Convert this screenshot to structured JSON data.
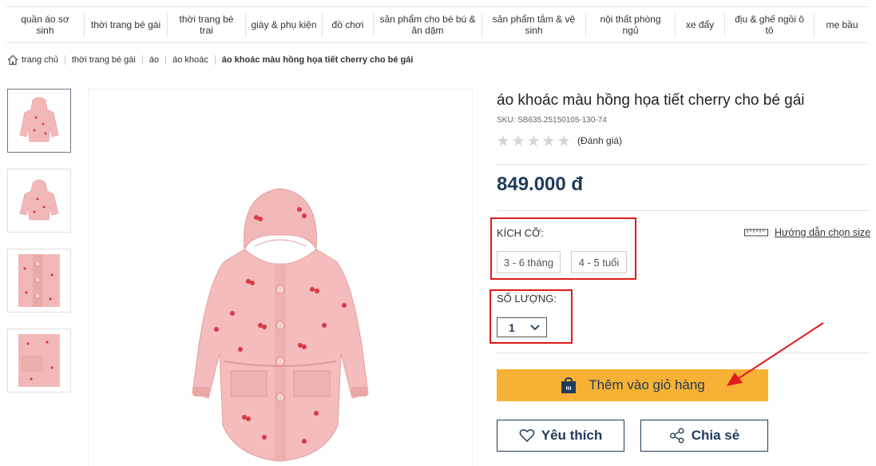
{
  "nav": {
    "items": [
      "quần áo sơ sinh",
      "thời trang bé gái",
      "thời trang bé trai",
      "giày & phụ kiện",
      "đồ chơi",
      "sản phẩm cho bé bú & ăn dặm",
      "sản phẩm tắm & vệ sinh",
      "nội thất phòng ngủ",
      "xe đẩy",
      "địu & ghế ngồi ô tô",
      "mẹ bầu"
    ]
  },
  "breadcrumb": {
    "items": [
      "trang chủ",
      "thời trang bé gái",
      "áo",
      "áo khoác",
      "áo khoác màu hồng họa tiết cherry cho bé gái"
    ]
  },
  "product": {
    "title": "áo khoác màu hồng họa tiết cherry cho bé gái",
    "sku": "SKU:  SB635.25150105-130-74",
    "rating_stars": 0,
    "review_link": "(Đánh giá)",
    "price": "849.000 đ",
    "size_label": "KÍCH CỠ:",
    "size_guide": "Hướng dẫn chọn size",
    "sizes": [
      "3 - 6 tháng",
      "4 - 5 tuổi"
    ],
    "qty_label": "SỐ LƯỢNG:",
    "qty_value": "1",
    "add_to_cart": "Thêm vào giỏ hàng",
    "wishlist": "Yêu thích",
    "share": "Chia sẻ"
  },
  "colors": {
    "brand_navy": "#1f3b5a",
    "cart_yellow": "#f7b135",
    "annotation_red": "#e11a1a",
    "coat_pink": "#f2b8b8"
  }
}
